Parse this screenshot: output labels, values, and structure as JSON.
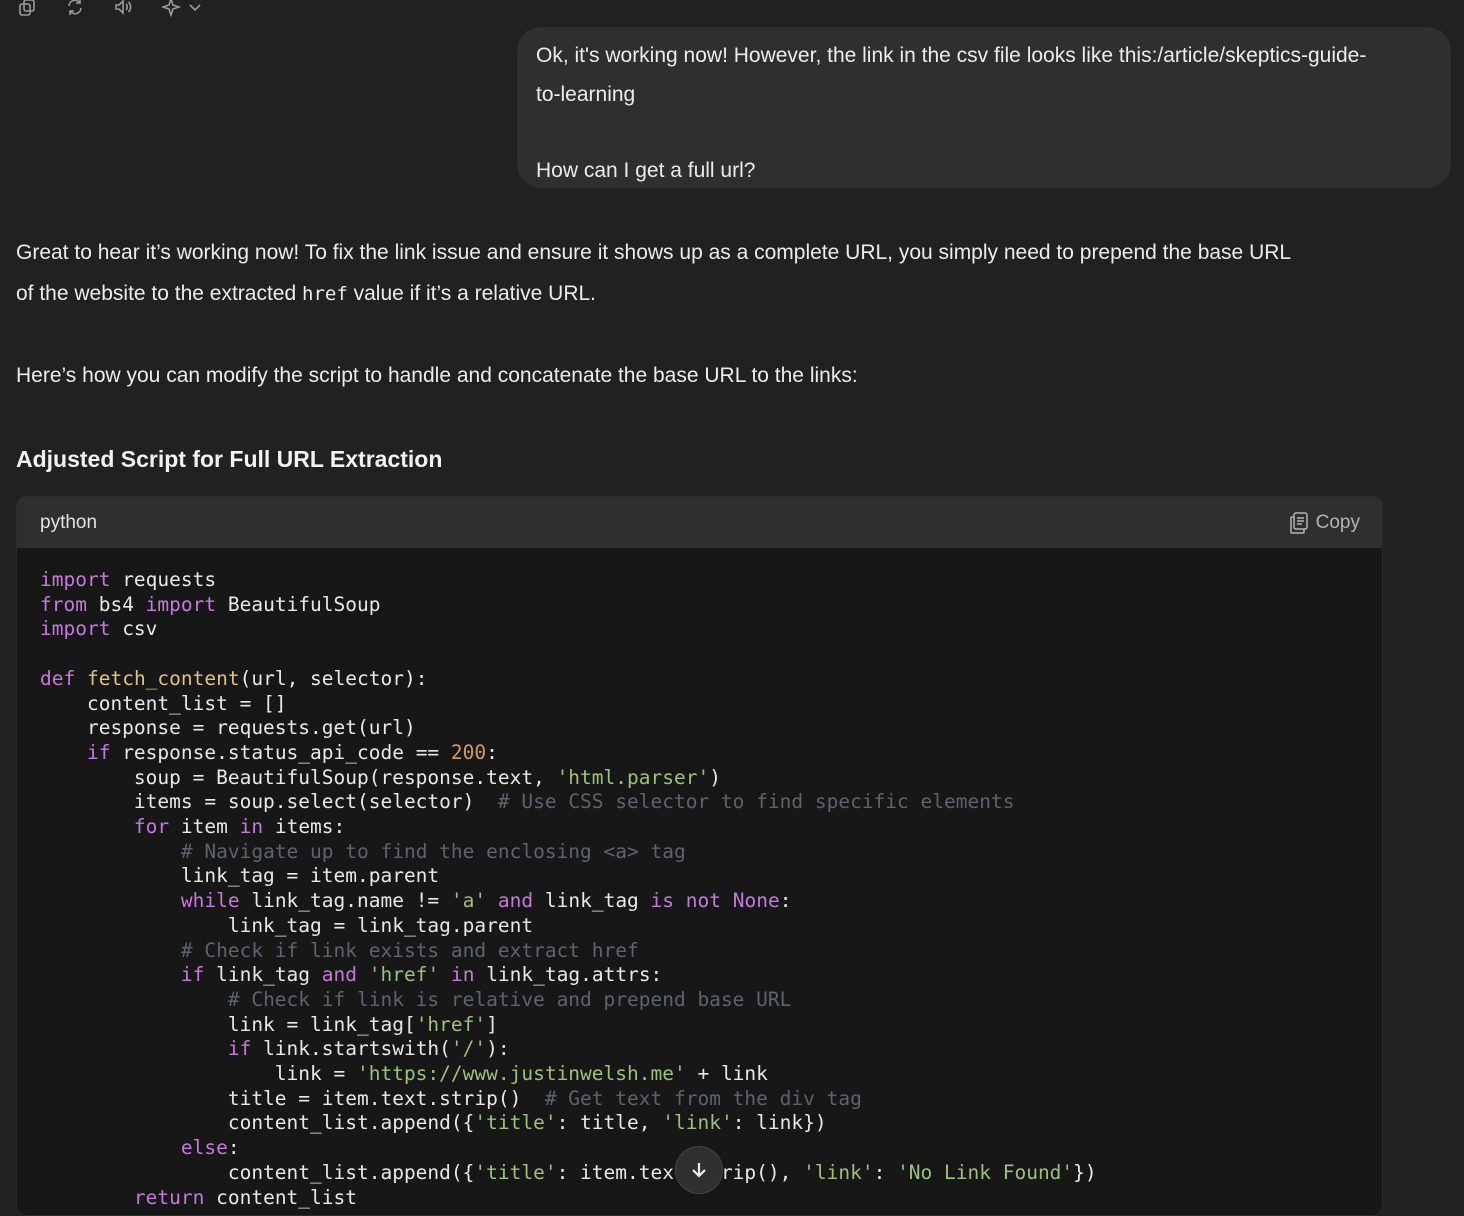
{
  "message_actions": {
    "icons": [
      "copy-icon",
      "regenerate-icon",
      "read-aloud-icon",
      "sparkle-model-icon",
      "chevron-down-icon"
    ]
  },
  "user_message": {
    "line1": "Ok, it's working now! However, the link in the csv file looks like this:/article/skeptics-guide-",
    "line2": "to-learning",
    "line3": "How can I get a full url?"
  },
  "assistant": {
    "para1_a": "Great to hear it’s working now! To fix the link issue and ensure it shows up as a complete URL, you simply need to prepend the base URL",
    "para1_b": "of the website to the extracted ",
    "para1_code": "href",
    "para1_c": " value if it’s a relative URL.",
    "para2": "Here’s how you can modify the script to handle and concatenate the base URL to the links:",
    "heading": "Adjusted Script for Full URL Extraction",
    "code_block": {
      "language": "python",
      "copy_label": "Copy"
    }
  },
  "scroll_button": {
    "icon": "arrow-down-icon"
  }
}
